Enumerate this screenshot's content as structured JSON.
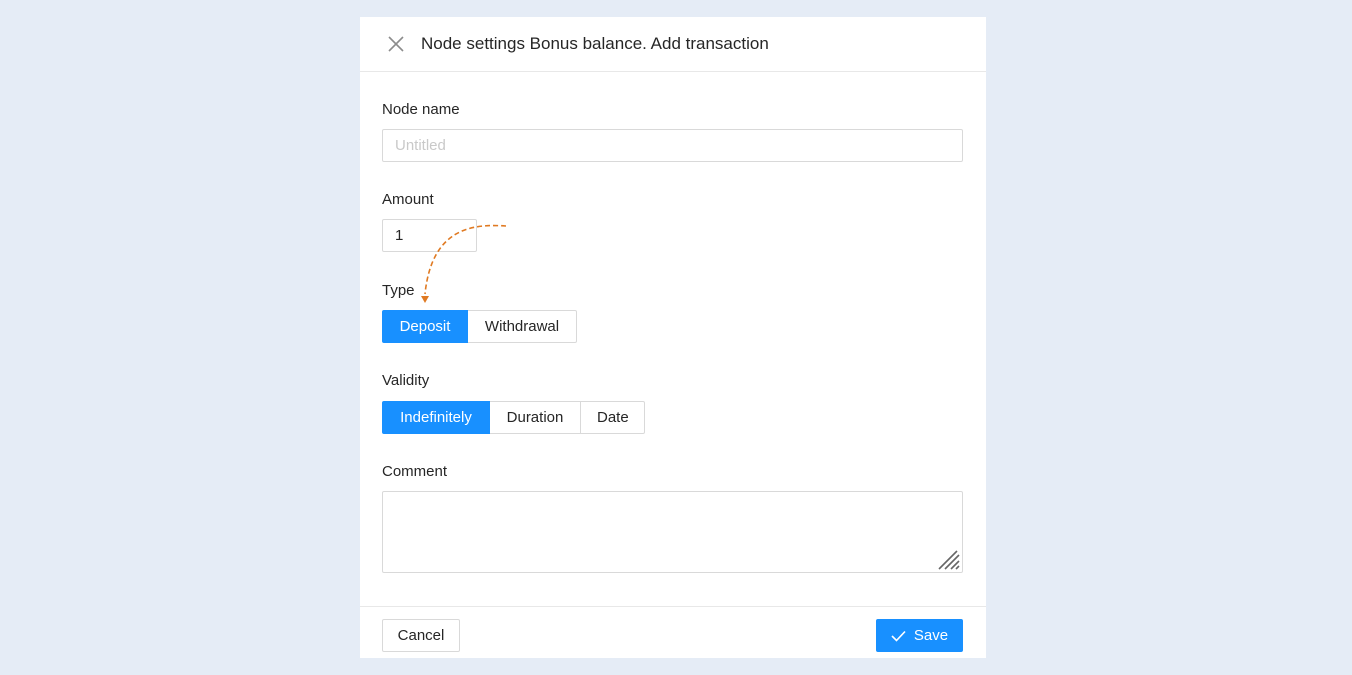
{
  "dialog": {
    "title": "Node settings Bonus balance. Add transaction",
    "close_icon": "close-icon"
  },
  "fields": {
    "node_name": {
      "label": "Node name",
      "value": "",
      "placeholder": "Untitled"
    },
    "amount": {
      "label": "Amount",
      "value": "1"
    },
    "type": {
      "label": "Type",
      "options": [
        "Deposit",
        "Withdrawal"
      ],
      "selected": "Deposit"
    },
    "validity": {
      "label": "Validity",
      "options": [
        "Indefinitely",
        "Duration",
        "Date"
      ],
      "selected": "Indefinitely"
    },
    "comment": {
      "label": "Comment",
      "value": ""
    }
  },
  "footer": {
    "cancel_label": "Cancel",
    "save_label": "Save",
    "save_icon": "check-icon"
  },
  "colors": {
    "background": "#e5ecf6",
    "accent": "#1890ff",
    "hint_arrow": "#e07a22"
  }
}
